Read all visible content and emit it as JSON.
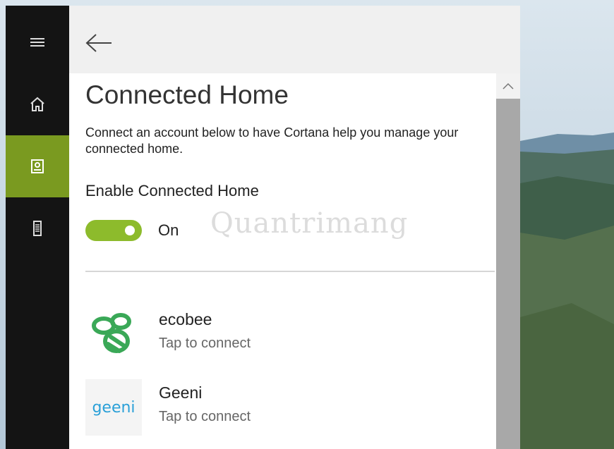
{
  "colors": {
    "accent": "#7a9a20",
    "toggle_on": "#8dbb2c",
    "ecobee_green": "#3aa857",
    "geeni_blue": "#2aa0d8",
    "sidebar_bg": "#141414"
  },
  "sidebar": {
    "items": [
      {
        "icon": "hamburger-menu-icon"
      },
      {
        "icon": "home-icon"
      },
      {
        "icon": "notebook-icon",
        "active": true
      },
      {
        "icon": "device-icon"
      }
    ]
  },
  "header": {
    "back_icon": "back-arrow-icon"
  },
  "main": {
    "title": "Connected Home",
    "description": "Connect an account below to have Cortana help you manage your connected home.",
    "enable_label": "Enable Connected Home",
    "toggle": {
      "on": true,
      "state_label": "On"
    },
    "watermark": "Quantrimang",
    "providers": [
      {
        "name": "ecobee",
        "subtitle": "Tap to connect",
        "logo_icon": "ecobee-bee-logo"
      },
      {
        "name": "Geeni",
        "subtitle": "Tap to connect",
        "logo_icon": "geeni-logo",
        "logo_text": "geeni"
      }
    ]
  },
  "scrollbar": {
    "up_icon": "chevron-up-icon"
  }
}
